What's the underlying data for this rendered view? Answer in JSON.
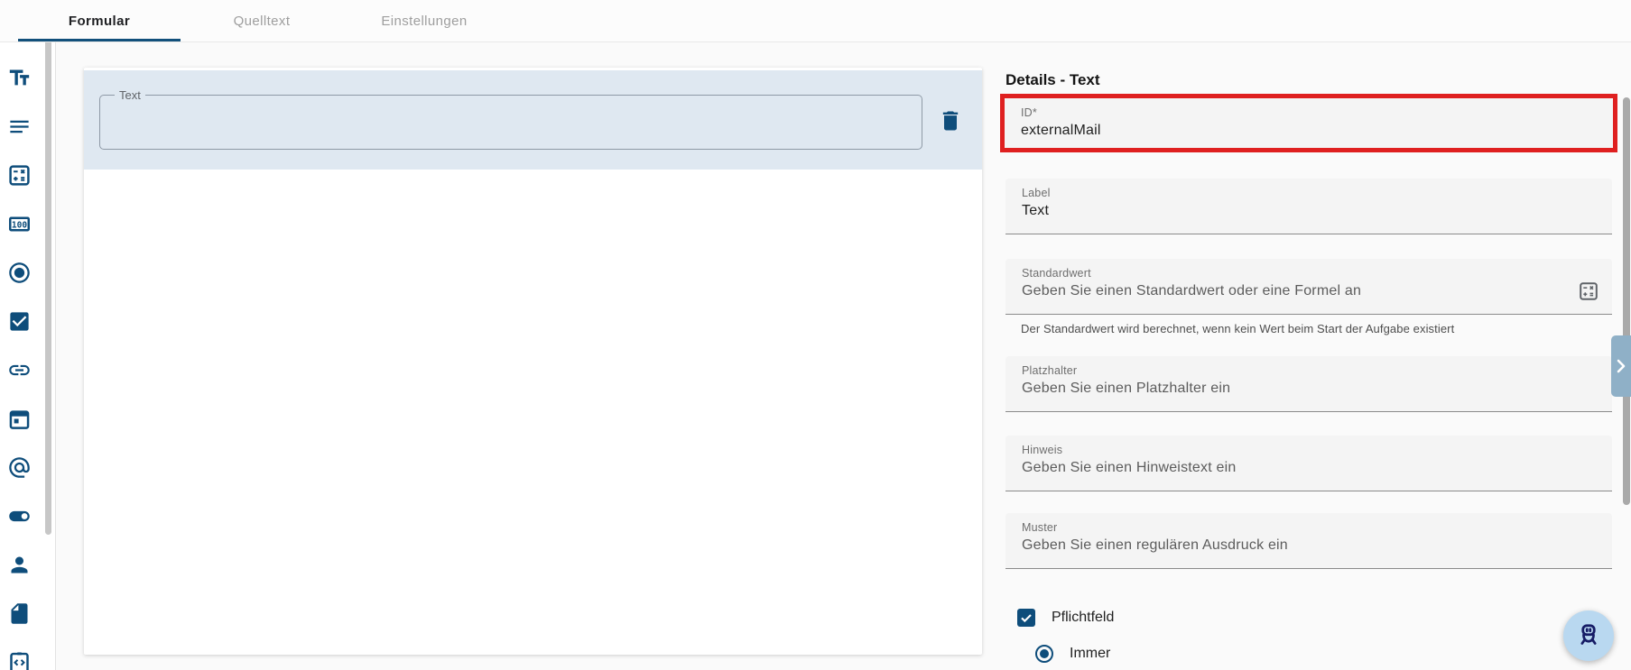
{
  "tabs": [
    {
      "label": "Formular",
      "active": true
    },
    {
      "label": "Quelltext",
      "active": false
    },
    {
      "label": "Einstellungen",
      "active": false
    }
  ],
  "palette": {
    "items": [
      "text-field-icon",
      "multiline-text-icon",
      "calculator-icon",
      "number-icon",
      "radio-icon",
      "checkbox-icon",
      "link-icon",
      "date-icon",
      "email-icon",
      "toggle-icon",
      "user-icon",
      "file-icon",
      "code-icon"
    ]
  },
  "canvas": {
    "component": {
      "label": "Text",
      "value": ""
    },
    "delete_icon": "trash-icon"
  },
  "details": {
    "title": "Details - Text",
    "fields": [
      {
        "key": "id",
        "label": "ID*",
        "value": "externalMail",
        "highlighted": true
      },
      {
        "key": "label",
        "label": "Label",
        "value": "Text"
      },
      {
        "key": "default",
        "label": "Standardwert",
        "placeholder": "Geben Sie einen Standardwert oder eine Formel an",
        "helper": "Der Standardwert wird berechnet, wenn kein Wert beim Start der Aufgabe existiert",
        "suffix_icon": "calculator-icon"
      },
      {
        "key": "placeholder",
        "label": "Platzhalter",
        "placeholder": "Geben Sie einen Platzhalter ein"
      },
      {
        "key": "hint",
        "label": "Hinweis",
        "placeholder": "Geben Sie einen Hinweistext ein"
      },
      {
        "key": "pattern",
        "label": "Muster",
        "placeholder": "Geben Sie einen regulären Ausdruck ein"
      }
    ],
    "required": {
      "label": "Pflichtfeld",
      "checked": true
    },
    "required_condition": {
      "label": "Immer",
      "selected": true
    }
  },
  "floating_button": {
    "icon": "robot-icon"
  },
  "colors": {
    "primary_blue": "#0e4d7b",
    "tab_indicator": "#12507b",
    "selected_row_bg": "#dfe8f1",
    "annotation_red": "#df2020",
    "field_bg": "#f4f4f4",
    "fab_bg": "#b9d8f0",
    "fab_icon": "#161c66",
    "handle_bg": "#8fb0c7"
  }
}
